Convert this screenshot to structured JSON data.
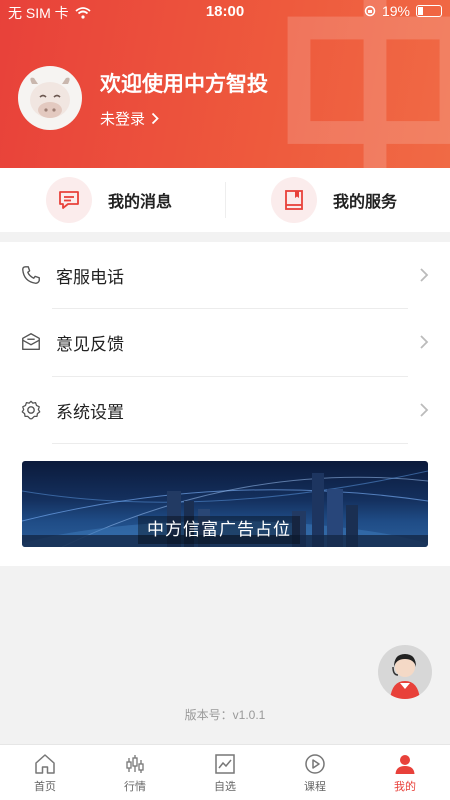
{
  "status_bar": {
    "carrier": "无 SIM 卡",
    "time": "18:00",
    "battery": "19%"
  },
  "header": {
    "welcome": "欢迎使用中方智投",
    "login_status": "未登录"
  },
  "quick": [
    {
      "label": "我的消息",
      "icon": "message-icon"
    },
    {
      "label": "我的服务",
      "icon": "book-icon"
    }
  ],
  "menu": [
    {
      "label": "客服电话",
      "icon": "phone-icon"
    },
    {
      "label": "意见反馈",
      "icon": "feedback-mail-icon"
    },
    {
      "label": "系统设置",
      "icon": "gear-icon"
    }
  ],
  "banner": {
    "text": "中方信富广告占位"
  },
  "version": "版本号：v1.0.1",
  "tabs": [
    {
      "label": "首页",
      "icon": "home-icon"
    },
    {
      "label": "行情",
      "icon": "candlestick-icon"
    },
    {
      "label": "自选",
      "icon": "chart-icon"
    },
    {
      "label": "课程",
      "icon": "play-icon"
    },
    {
      "label": "我的",
      "icon": "user-icon"
    }
  ],
  "colors": {
    "accent": "#e8413a",
    "background": "#f2f2f2"
  }
}
